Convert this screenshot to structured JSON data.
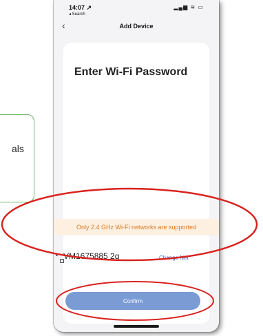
{
  "callout": {
    "text": "als"
  },
  "status_bar": {
    "time": "14:07 ↗",
    "back_app": "◂ Search",
    "icons": "▂▄▆ ≋ ▭"
  },
  "nav": {
    "back_icon": "‹",
    "title": "Add Device"
  },
  "page": {
    "heading": "Enter Wi-Fi Password"
  },
  "banner": {
    "text": "Only 2.4 GHz Wi-Fi networks are supported",
    "color": "#d97a2b",
    "background": "#fdf0e0"
  },
  "network": {
    "wifi_icon": "wifi-icon",
    "name": "VM1675885 2g",
    "change_label": "Change Net"
  },
  "confirm": {
    "label": "Confirm",
    "color": "#7b9bd4"
  },
  "annotations": {
    "ellipse_color": "#d9231f",
    "callout_border_color": "#6cb86c"
  }
}
